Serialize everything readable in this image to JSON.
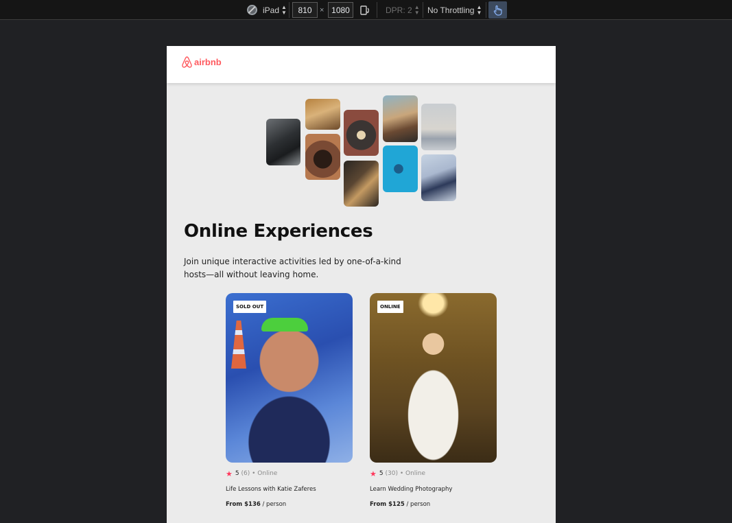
{
  "toolbar": {
    "device": "iPad",
    "width": "810",
    "x_sep": "×",
    "height": "1080",
    "dpr": "DPR: 2",
    "throttling": "No Throttling"
  },
  "header": {
    "brand": "airbnb"
  },
  "hero": {
    "headline": "Online Experiences",
    "subtext": "Join unique interactive activities led by one-of-a-kind hosts—all without leaving home."
  },
  "cards": [
    {
      "badge": "SOLD OUT",
      "rating": "5",
      "reviews": "(6)",
      "location": "• Online",
      "title": "Life Lessons with Katie Zaferes",
      "price_prefix": "From $136",
      "price_suffix": " / person",
      "image": "athlete-swimmer-photo"
    },
    {
      "badge": "ONLINE",
      "rating": "5",
      "reviews": "(30)",
      "location": "• Online",
      "title": "Learn Wedding Photography",
      "price_prefix": "From $125",
      "price_suffix": " / person",
      "image": "bride-photo"
    }
  ],
  "colors": {
    "brand": "#ff5a5f",
    "star": "#ff385c",
    "page_bg": "#ebebeb"
  }
}
